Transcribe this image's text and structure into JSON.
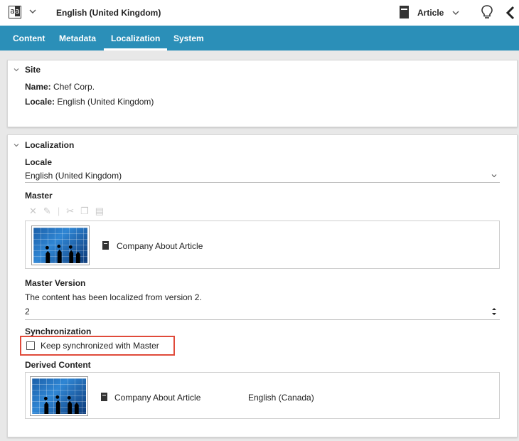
{
  "header": {
    "language_title": "English (United Kingdom)",
    "content_type": "Article",
    "icons": [
      "app-logo-icon",
      "chevron-down-icon",
      "article-type-icon",
      "lightbulb-icon",
      "back-arrow-icon"
    ]
  },
  "tabs": [
    {
      "label": "Content"
    },
    {
      "label": "Metadata"
    },
    {
      "label": "Localization",
      "active": true
    },
    {
      "label": "System"
    }
  ],
  "site": {
    "title": "Site",
    "name_label": "Name:",
    "name_value": "Chef Corp.",
    "locale_label": "Locale:",
    "locale_value": "English (United Kingdom)"
  },
  "localization": {
    "title": "Localization",
    "locale_label": "Locale",
    "locale_value": "English (United Kingdom)",
    "master_label": "Master",
    "master_item": "Company About Article",
    "master_version_label": "Master Version",
    "master_version_note": "The content has been localized from version 2.",
    "master_version_value": "2",
    "sync_label": "Synchronization",
    "sync_checkbox_label": "Keep synchronized with Master",
    "sync_checked": false,
    "derived_label": "Derived Content",
    "derived_item": "Company About Article",
    "derived_locale": "English (Canada)"
  },
  "colors": {
    "tab_bar": "#2b8fb8",
    "highlight": "#e04a3a"
  }
}
